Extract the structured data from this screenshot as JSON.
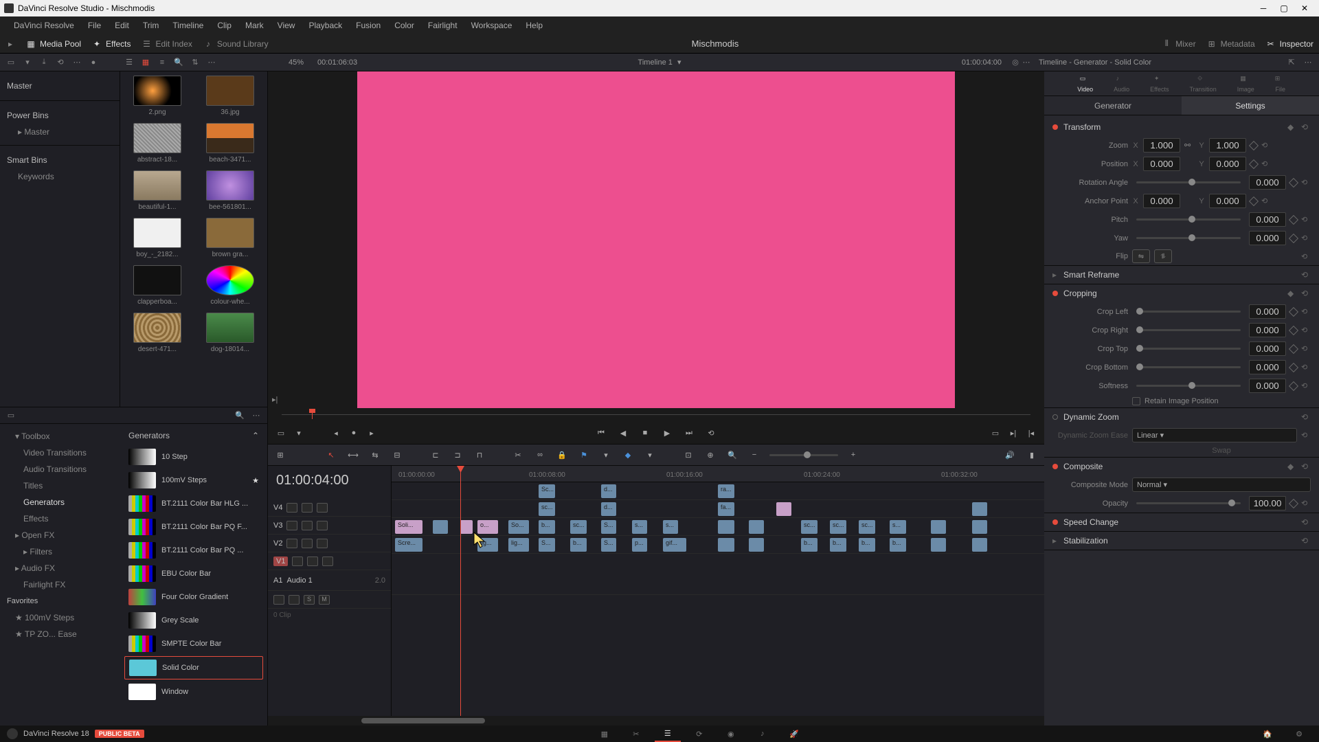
{
  "titlebar": {
    "text": "DaVinci Resolve Studio - Mischmodis"
  },
  "menubar": [
    "DaVinci Resolve",
    "File",
    "Edit",
    "Trim",
    "Timeline",
    "Clip",
    "Mark",
    "View",
    "Playback",
    "Fusion",
    "Color",
    "Fairlight",
    "Workspace",
    "Help"
  ],
  "tabs": {
    "media_pool": "Media Pool",
    "effects": "Effects",
    "edit_index": "Edit Index",
    "sound_library": "Sound Library",
    "mixer": "Mixer",
    "metadata": "Metadata",
    "inspector": "Inspector"
  },
  "project_title": "Mischmodis",
  "toolrow": {
    "zoom_pct": "45%",
    "tc1": "00:01:06:03",
    "timeline_name": "Timeline 1",
    "tc2": "01:00:04:00",
    "insp_title": "Timeline - Generator - Solid Color"
  },
  "media_pool": {
    "master": "Master",
    "power_bins": "Power Bins",
    "power_master": "Master",
    "smart_bins": "Smart Bins",
    "keywords": "Keywords",
    "thumbs": [
      {
        "label": "2.png",
        "cls": "bg-flare"
      },
      {
        "label": "36.jpg",
        "cls": "bg-brown"
      },
      {
        "label": "abstract-18...",
        "cls": "bg-noise"
      },
      {
        "label": "beach-3471...",
        "cls": "bg-beach"
      },
      {
        "label": "beautiful-1...",
        "cls": "bg-portrait"
      },
      {
        "label": "bee-561801...",
        "cls": "bg-flower"
      },
      {
        "label": "boy_-_2182...",
        "cls": "bg-white"
      },
      {
        "label": "brown gra...",
        "cls": "bg-tex"
      },
      {
        "label": "clapperboa...",
        "cls": "bg-clap"
      },
      {
        "label": "colour-whe...",
        "cls": "bg-wheel"
      },
      {
        "label": "desert-471...",
        "cls": "bg-desert"
      },
      {
        "label": "dog-18014...",
        "cls": "bg-dog"
      }
    ]
  },
  "fx": {
    "toolbox": "Toolbox",
    "tree": [
      "Video Transitions",
      "Audio Transitions",
      "Titles",
      "Generators",
      "Effects"
    ],
    "openfx": "Open FX",
    "filters": "Filters",
    "audiofx": "Audio FX",
    "fairlightfx": "Fairlight FX",
    "favorites": "Favorites",
    "fav_items": [
      "100mV Steps",
      "TP ZO... Ease"
    ],
    "header": "Generators",
    "items": [
      {
        "label": "10 Step",
        "cls": "sw-steps"
      },
      {
        "label": "100mV Steps",
        "cls": "sw-steps",
        "star": true
      },
      {
        "label": "BT.2111 Color Bar HLG ...",
        "cls": "sw-bars"
      },
      {
        "label": "BT.2111 Color Bar PQ F...",
        "cls": "sw-bars"
      },
      {
        "label": "BT.2111 Color Bar PQ ...",
        "cls": "sw-bars"
      },
      {
        "label": "EBU Color Bar",
        "cls": "sw-bars"
      },
      {
        "label": "Four Color Gradient",
        "cls": "sw-gradient"
      },
      {
        "label": "Grey Scale",
        "cls": "sw-grey"
      },
      {
        "label": "SMPTE Color Bar",
        "cls": "sw-bars"
      },
      {
        "label": "Solid Color",
        "cls": "sw-solid",
        "selected": true
      },
      {
        "label": "Window",
        "cls": "sw-window"
      }
    ]
  },
  "timeline": {
    "tc": "01:00:04:00",
    "ruler": [
      "01:00:00:00",
      "01:00:08:00",
      "01:00:16:00",
      "01:00:24:00",
      "01:00:32:00"
    ],
    "tracks": {
      "v4": "V4",
      "v3": "V3",
      "v2": "V2",
      "v1": "V1",
      "a1": "A1",
      "a1_name": "Audio 1",
      "a1_ch": "2.0",
      "clip_count": "0 Clip"
    }
  },
  "inspector": {
    "tabs": {
      "video": "Video",
      "audio": "Audio",
      "effects": "Effects",
      "transition": "Transition",
      "image": "Image",
      "file": "File"
    },
    "subtabs": {
      "generator": "Generator",
      "settings": "Settings"
    },
    "transform": {
      "title": "Transform",
      "zoom": "Zoom",
      "zoom_x": "1.000",
      "zoom_y": "1.000",
      "position": "Position",
      "pos_x": "0.000",
      "pos_y": "0.000",
      "rotation": "Rotation Angle",
      "rot_v": "0.000",
      "anchor": "Anchor Point",
      "anc_x": "0.000",
      "anc_y": "0.000",
      "pitch": "Pitch",
      "pitch_v": "0.000",
      "yaw": "Yaw",
      "yaw_v": "0.000",
      "flip": "Flip"
    },
    "smart_reframe": "Smart Reframe",
    "cropping": {
      "title": "Cropping",
      "left": "Crop Left",
      "left_v": "0.000",
      "right": "Crop Right",
      "right_v": "0.000",
      "top": "Crop Top",
      "top_v": "0.000",
      "bottom": "Crop Bottom",
      "bottom_v": "0.000",
      "softness": "Softness",
      "soft_v": "0.000",
      "retain": "Retain Image Position"
    },
    "dynamic_zoom": {
      "title": "Dynamic Zoom",
      "ease": "Dynamic Zoom Ease",
      "ease_v": "Linear",
      "swap": "Swap"
    },
    "composite": {
      "title": "Composite",
      "mode": "Composite Mode",
      "mode_v": "Normal",
      "opacity": "Opacity",
      "opacity_v": "100.00"
    },
    "speed": "Speed Change",
    "stab": "Stabilization"
  },
  "pagebar": {
    "app": "DaVinci Resolve 18",
    "beta": "PUBLIC BETA"
  }
}
